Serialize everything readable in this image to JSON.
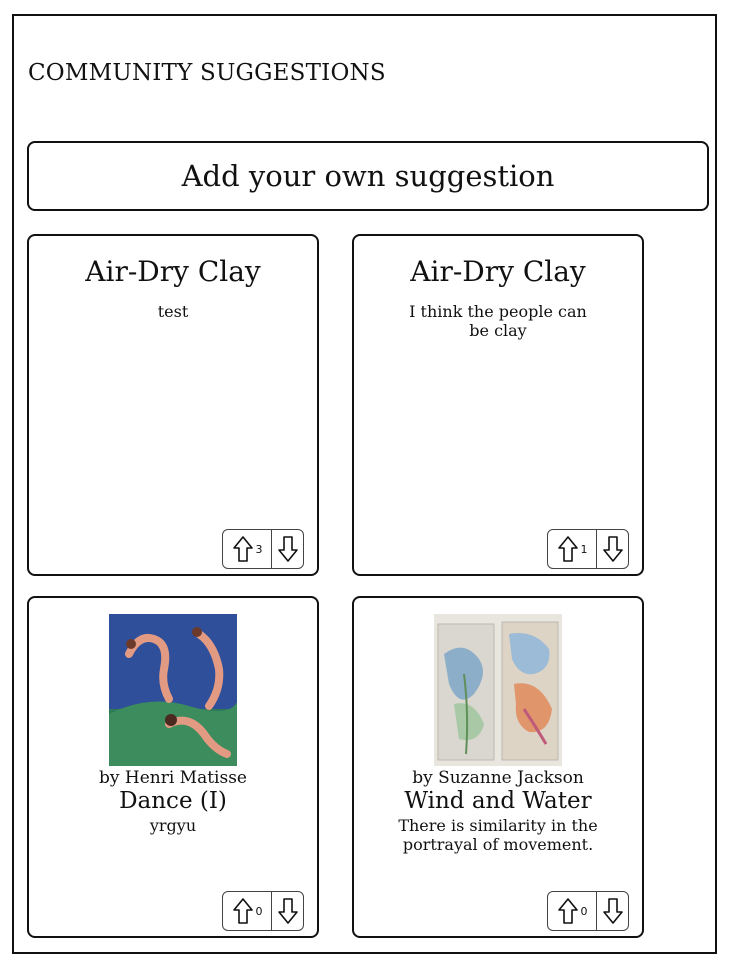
{
  "page": {
    "heading": "COMMUNITY SUGGESTIONS",
    "add_button_label": "Add your own suggestion"
  },
  "cards": [
    {
      "title": "Air-Dry Clay",
      "text": "test",
      "upvotes": "3",
      "up_icon": "arrow-up-icon",
      "down_icon": "arrow-down-icon"
    },
    {
      "title": "Air-Dry Clay",
      "text": "I think the people can be clay",
      "upvotes": "1",
      "up_icon": "arrow-up-icon",
      "down_icon": "arrow-down-icon"
    },
    {
      "byline": "by Henri Matisse",
      "title": "Dance (I)",
      "text": "yrgyu",
      "upvotes": "0",
      "image": "artwork-thumbnail"
    },
    {
      "byline": "by Suzanne Jackson",
      "title": "Wind and Water",
      "text": "There is similarity in the portrayal of movement.",
      "upvotes": "0",
      "image": "artwork-thumbnail"
    }
  ]
}
